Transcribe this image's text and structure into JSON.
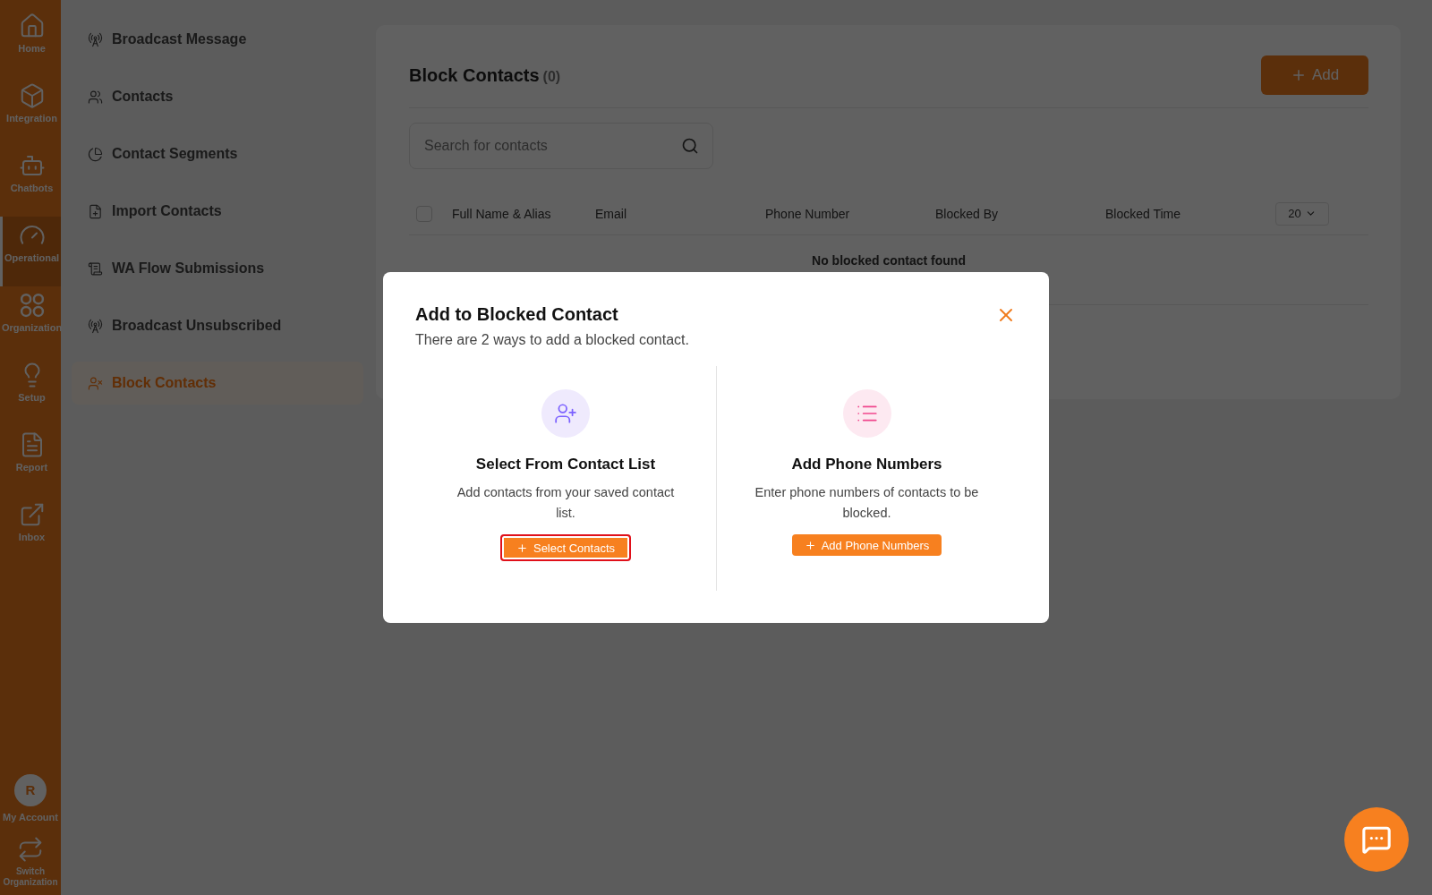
{
  "rail": {
    "items": [
      {
        "label": "Home",
        "selected": false
      },
      {
        "label": "Integration",
        "selected": false
      },
      {
        "label": "Chatbots",
        "selected": false
      },
      {
        "label": "Operational",
        "selected": true
      },
      {
        "label": "Organization",
        "selected": false
      },
      {
        "label": "Setup",
        "selected": false
      },
      {
        "label": "Report",
        "selected": false
      },
      {
        "label": "Inbox",
        "selected": false
      }
    ],
    "account": {
      "initial": "R",
      "label": "My Account"
    },
    "switch": {
      "label": "Switch Organization"
    }
  },
  "sidebar": {
    "items": [
      {
        "label": "Broadcast Message",
        "selected": false
      },
      {
        "label": "Contacts",
        "selected": false
      },
      {
        "label": "Contact Segments",
        "selected": false
      },
      {
        "label": "Import Contacts",
        "selected": false
      },
      {
        "label": "WA Flow Submissions",
        "selected": false
      },
      {
        "label": "Broadcast Unsubscribed",
        "selected": false
      },
      {
        "label": "Block Contacts",
        "selected": true
      }
    ]
  },
  "page": {
    "title": "Block Contacts",
    "count": "(0)",
    "add_button": "Add",
    "search": {
      "placeholder": "Search for contacts"
    },
    "table": {
      "select_all": {
        "checked": false
      },
      "columns": [
        "Full Name & Alias",
        "Email",
        "Phone Number",
        "Blocked By",
        "Blocked Time"
      ],
      "page_size": "20",
      "empty": "No blocked contact found"
    }
  },
  "modal": {
    "title": "Add to Blocked Contact",
    "subtitle": "There are 2 ways to add a blocked contact.",
    "options": [
      {
        "kind": "contacts",
        "title": "Select From Contact List",
        "description": "Add contacts from your saved contact list.",
        "button": "Select Contacts",
        "highlighted": true
      },
      {
        "kind": "phones",
        "title": "Add Phone Numbers",
        "description": "Enter phone numbers of contacts to be blocked.",
        "button": "Add Phone Numbers",
        "highlighted": false
      }
    ]
  }
}
